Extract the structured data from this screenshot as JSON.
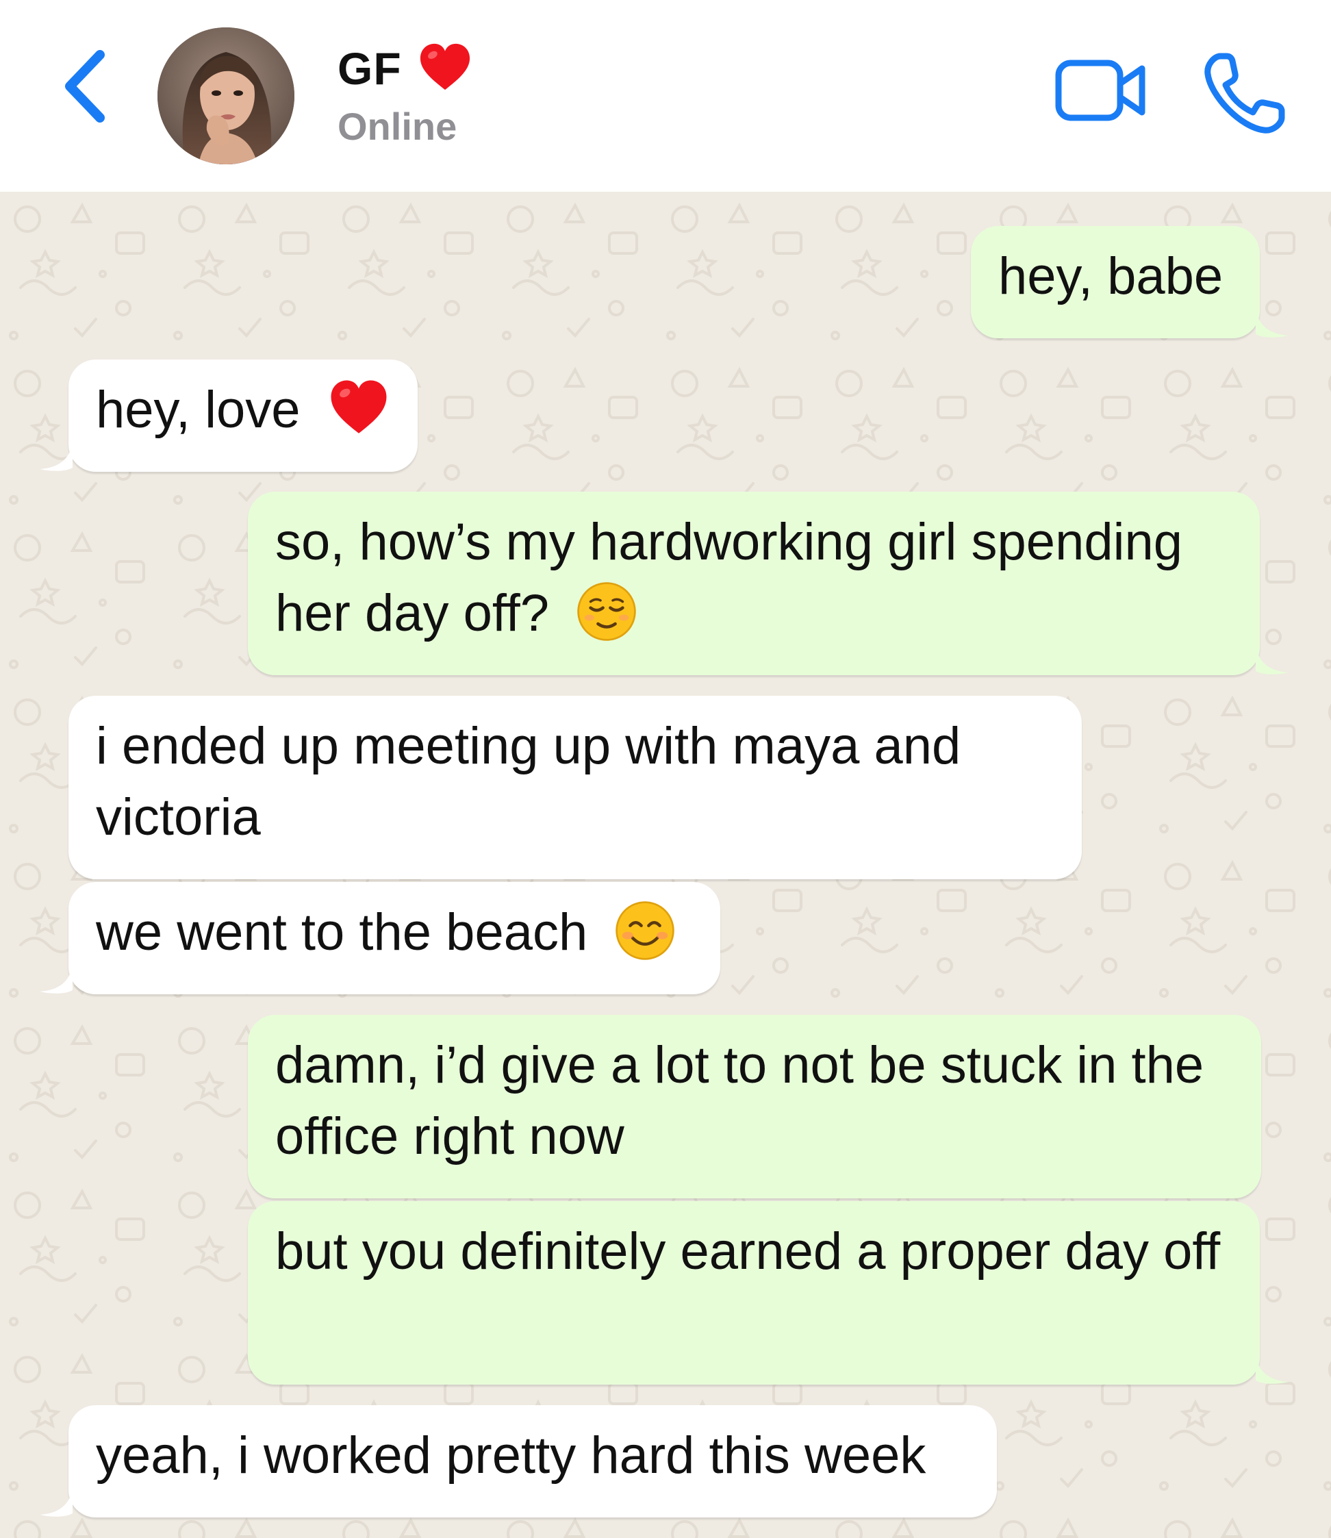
{
  "header": {
    "back_icon": "chevron-left-icon",
    "contact_name": "GF",
    "name_emoji": "heart-emoji",
    "status": "Online",
    "video_icon": "video-camera-icon",
    "call_icon": "phone-icon"
  },
  "colors": {
    "accent": "#1a7cf5",
    "outgoing_bubble": "#e7fdd8",
    "incoming_bubble": "#ffffff",
    "chat_background": "#efeae2",
    "status_text": "#8f8f94"
  },
  "messages": [
    {
      "direction": "outgoing",
      "text": "hey, babe"
    },
    {
      "direction": "incoming",
      "text": "hey, love",
      "emoji": "heart-emoji"
    },
    {
      "direction": "outgoing",
      "text": "so, how’s my hardworking girl spending her day off?",
      "emoji": "relieved-face-emoji"
    },
    {
      "direction": "incoming",
      "text": "i ended up meeting up with maya and victoria"
    },
    {
      "direction": "incoming",
      "text": "we went to the beach",
      "emoji": "smiling-face-emoji"
    },
    {
      "direction": "outgoing",
      "text": "damn, i’d give a lot to not be stuck in the office right now"
    },
    {
      "direction": "outgoing",
      "text": "but you definitely earned a proper day off"
    },
    {
      "direction": "incoming",
      "text": "yeah, i worked pretty hard this week"
    }
  ]
}
